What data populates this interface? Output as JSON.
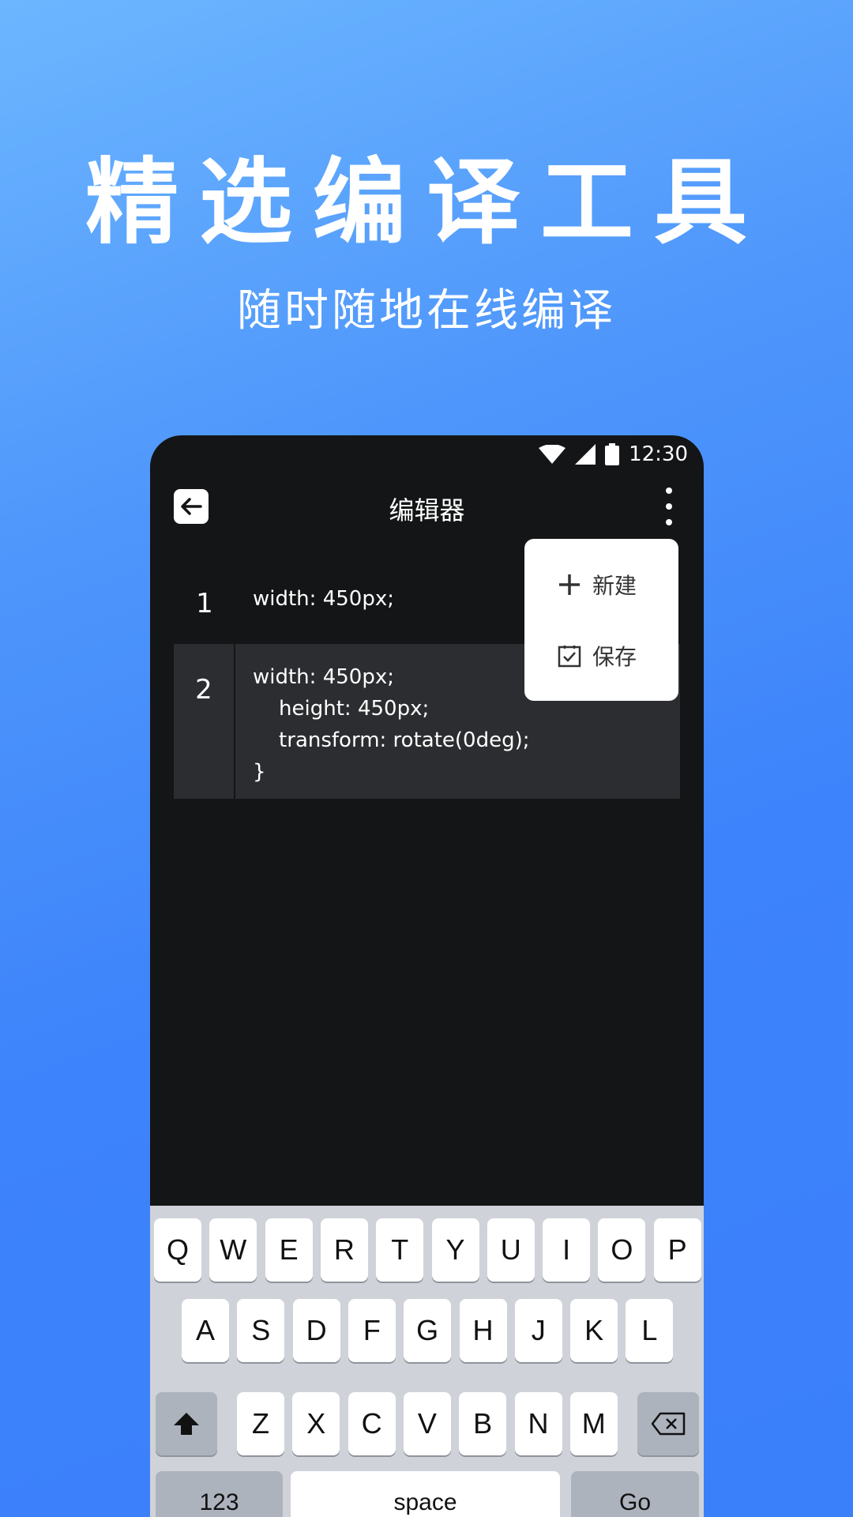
{
  "headline": "精选编译工具",
  "subline": "随时随地在线编译",
  "status_bar": {
    "time": "12:30"
  },
  "app_bar": {
    "title": "编辑器"
  },
  "editor": {
    "lines": [
      {
        "number": "1",
        "code": "width: 450px;"
      },
      {
        "number": "2",
        "code": "width: 450px;\n    height: 450px;\n    transform: rotate(0deg);\n}"
      }
    ]
  },
  "menu": {
    "new_label": "新建",
    "save_label": "保存"
  },
  "keyboard": {
    "row1": [
      "Q",
      "W",
      "E",
      "R",
      "T",
      "Y",
      "U",
      "I",
      "O",
      "P"
    ],
    "row2": [
      "A",
      "S",
      "D",
      "F",
      "G",
      "H",
      "J",
      "K",
      "L"
    ],
    "row3": [
      "Z",
      "X",
      "C",
      "V",
      "B",
      "N",
      "M"
    ],
    "numbers_label": "123",
    "space_label": "space",
    "go_label": "Go"
  },
  "colors": {
    "background_top": "#6cb6ff",
    "background_bottom": "#3b80fb",
    "editor_bg": "#141516",
    "active_line_bg": "#2c2d30",
    "keyboard_bg": "#cfd2d8"
  }
}
